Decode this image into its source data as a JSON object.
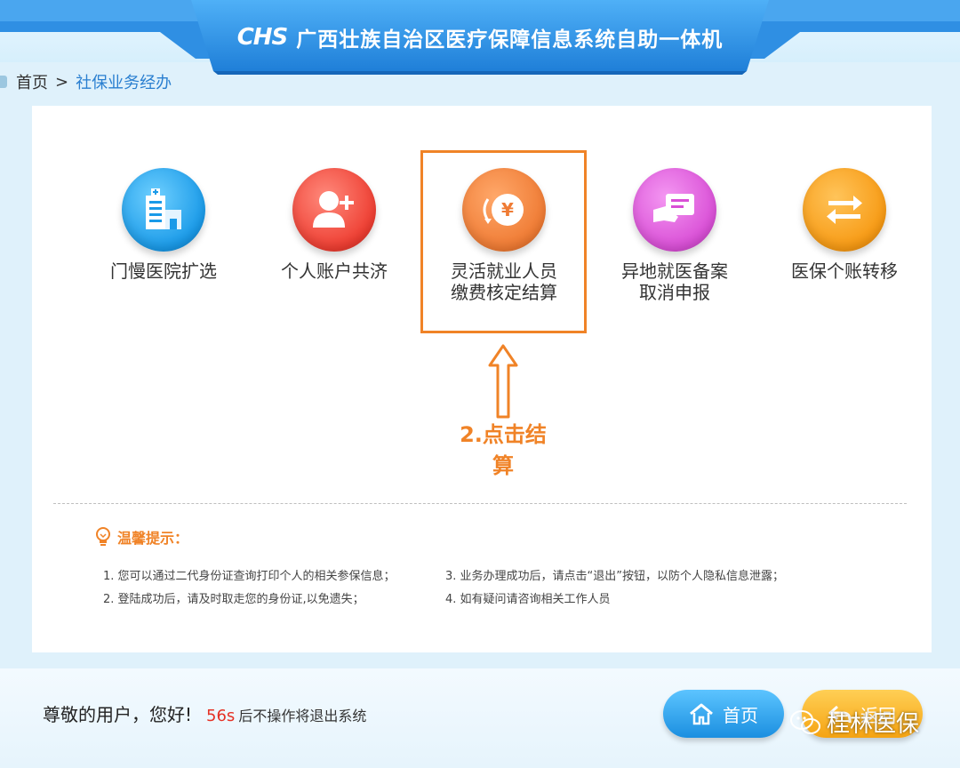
{
  "header": {
    "logo_text": "CHS",
    "title": "广西壮族自治区医疗保障信息系统自助一体机"
  },
  "breadcrumb": {
    "home": "首页",
    "separator": ">",
    "current": "社保业务经办"
  },
  "services": [
    {
      "label_line1": "门慢医院扩选",
      "label_line2": "",
      "icon": "hospital-icon",
      "color": "#1a9ae8"
    },
    {
      "label_line1": "个人账户共济",
      "label_line2": "",
      "icon": "add-user-icon",
      "color": "#ee3e32"
    },
    {
      "label_line1": "灵活就业人员",
      "label_line2": "缴费核定结算",
      "icon": "yuan-refund-icon",
      "color": "#ef7b34"
    },
    {
      "label_line1": "异地就医备案",
      "label_line2": "取消申报",
      "icon": "hand-card-icon",
      "color": "#d94fd6"
    },
    {
      "label_line1": "医保个账转移",
      "label_line2": "",
      "icon": "transfer-arrows-icon",
      "color": "#f79a14"
    }
  ],
  "annotation": {
    "text": "2.点击结算",
    "color": "#f08327"
  },
  "tips": {
    "heading": "温馨提示：",
    "items": [
      "1. 您可以通过二代身份证查询打印个人的相关参保信息；",
      "2. 登陆成功后，请及时取走您的身份证,以免遗失；",
      "3. 业务办理成功后，请点击“退出”按钮，以防个人隐私信息泄露；",
      "4. 如有疑问请咨询相关工作人员"
    ]
  },
  "footer": {
    "greeting": "尊敬的用户，您好!",
    "countdown": "56s",
    "hint": "后不操作将退出系统",
    "home_button": "首页",
    "back_button": "返回"
  },
  "watermark": "桂林医保"
}
